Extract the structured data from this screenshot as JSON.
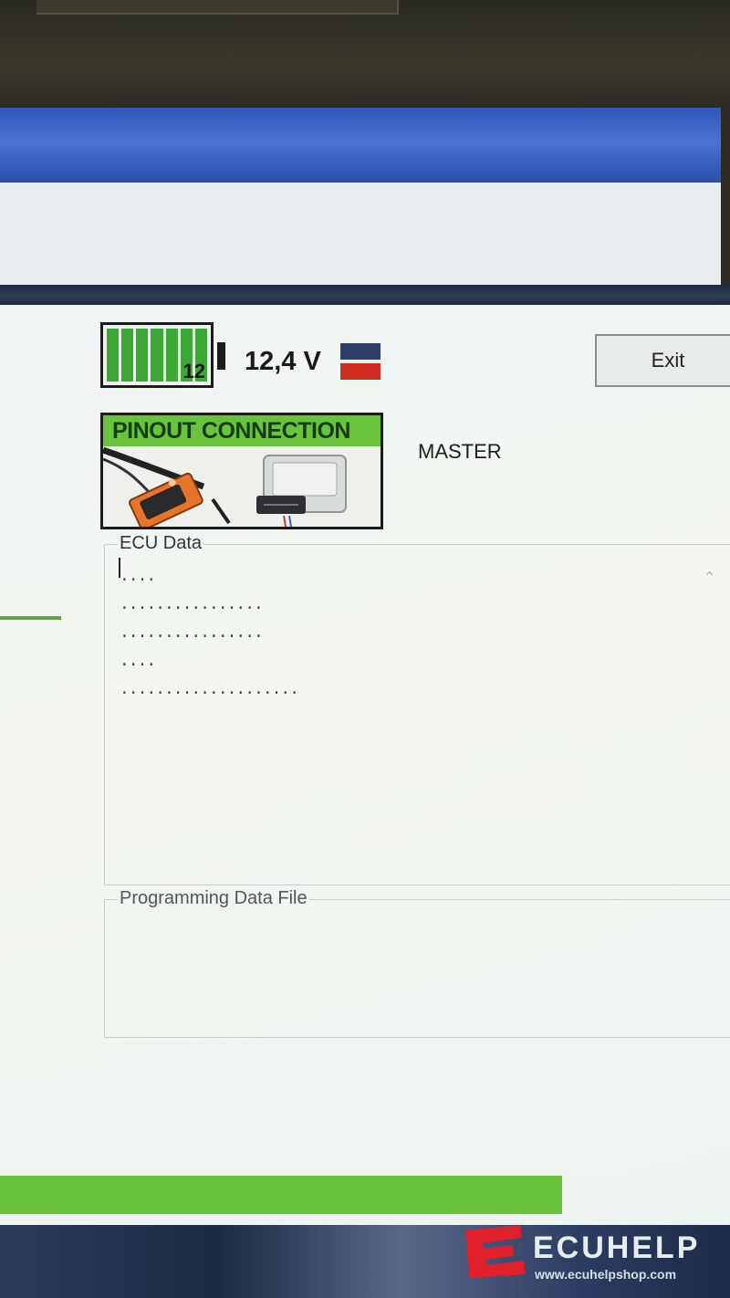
{
  "status": {
    "battery_number": "12",
    "battery_level": 0.85,
    "voltage": "12,4 V"
  },
  "exit_label": "Exit",
  "pinout": {
    "header": "PINOUT CONNECTION"
  },
  "mode_label": "MASTER",
  "ecu_data": {
    "legend": "ECU Data",
    "lines": [
      "....",
      "................",
      "................",
      "....",
      "...................."
    ]
  },
  "programming": {
    "legend": "Programming Data File"
  },
  "progress": {
    "value": 0.77
  },
  "watermark": {
    "brand": "ECUHELP",
    "site": "www.ecuhelpshop.com"
  },
  "colors": {
    "accent_green": "#69c13b",
    "title_blue": "#3b62c4",
    "flag_red": "#cf2c22",
    "flag_blue": "#2e3f6a"
  }
}
